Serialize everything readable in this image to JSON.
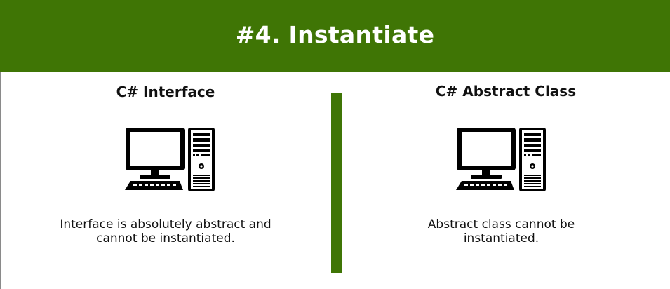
{
  "colors": {
    "accent_green": "#3f7505",
    "banner_text": "#ffffff",
    "body_text": "#111111"
  },
  "banner": {
    "title": "#4. Instantiate"
  },
  "left_panel": {
    "title": "C# Interface",
    "icon": "desktop-computer-icon",
    "description": "Interface is absolutely abstract and\ncannot be instantiated."
  },
  "right_panel": {
    "title": "C# Abstract Class",
    "icon": "desktop-computer-icon",
    "description": "Abstract class cannot be\ninstantiated."
  }
}
